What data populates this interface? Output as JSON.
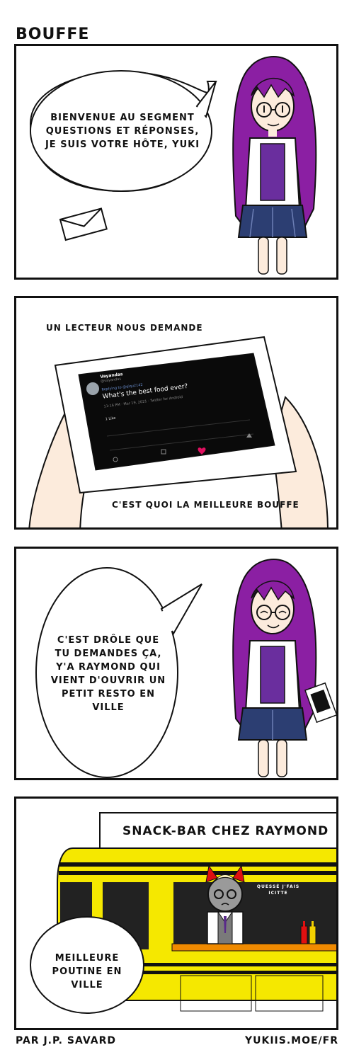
{
  "title": "BOUFFE",
  "panel1": {
    "speech": "BIENVENUE AU SEGMENT QUESTIONS ET RÉPONSES, JE SUIS VOTRE HÔTE, YUKI"
  },
  "panel2": {
    "caption": "UN LECTEUR NOUS DEMANDE",
    "tweet": {
      "name": "Vayandas",
      "handle": "@vayandas",
      "replying": "Replying to @qiqu2142",
      "text": "What's the best food ever?",
      "meta": "11:16 PM · Mar 19, 2021 · Twitter for Android",
      "likes": "1 Like"
    },
    "translation": "C'EST QUOI LA MEILLEURE BOUFFE"
  },
  "panel3": {
    "speech": "C'EST DRÔLE QUE TU DEMANDES ÇA, Y'A RAYMOND QUI VIENT D'OUVRIR UN PETIT RESTO EN VILLE"
  },
  "panel4": {
    "sign": "SNACK-BAR CHEZ RAYMOND",
    "whisper": "QUESSÉ J'FAIS ICITTE",
    "speech": "MEILLEURE POUTINE EN VILLE"
  },
  "footer": {
    "author": "PAR J.P. SAVARD",
    "site": "YUKIIS.MOE/FR"
  },
  "colors": {
    "hair": "#8B1FA3",
    "skirt": "#2C3E72",
    "bus": "#F5E800",
    "counter": "#F08A00",
    "ketchup": "#E01010",
    "mustard": "#F2D000"
  }
}
